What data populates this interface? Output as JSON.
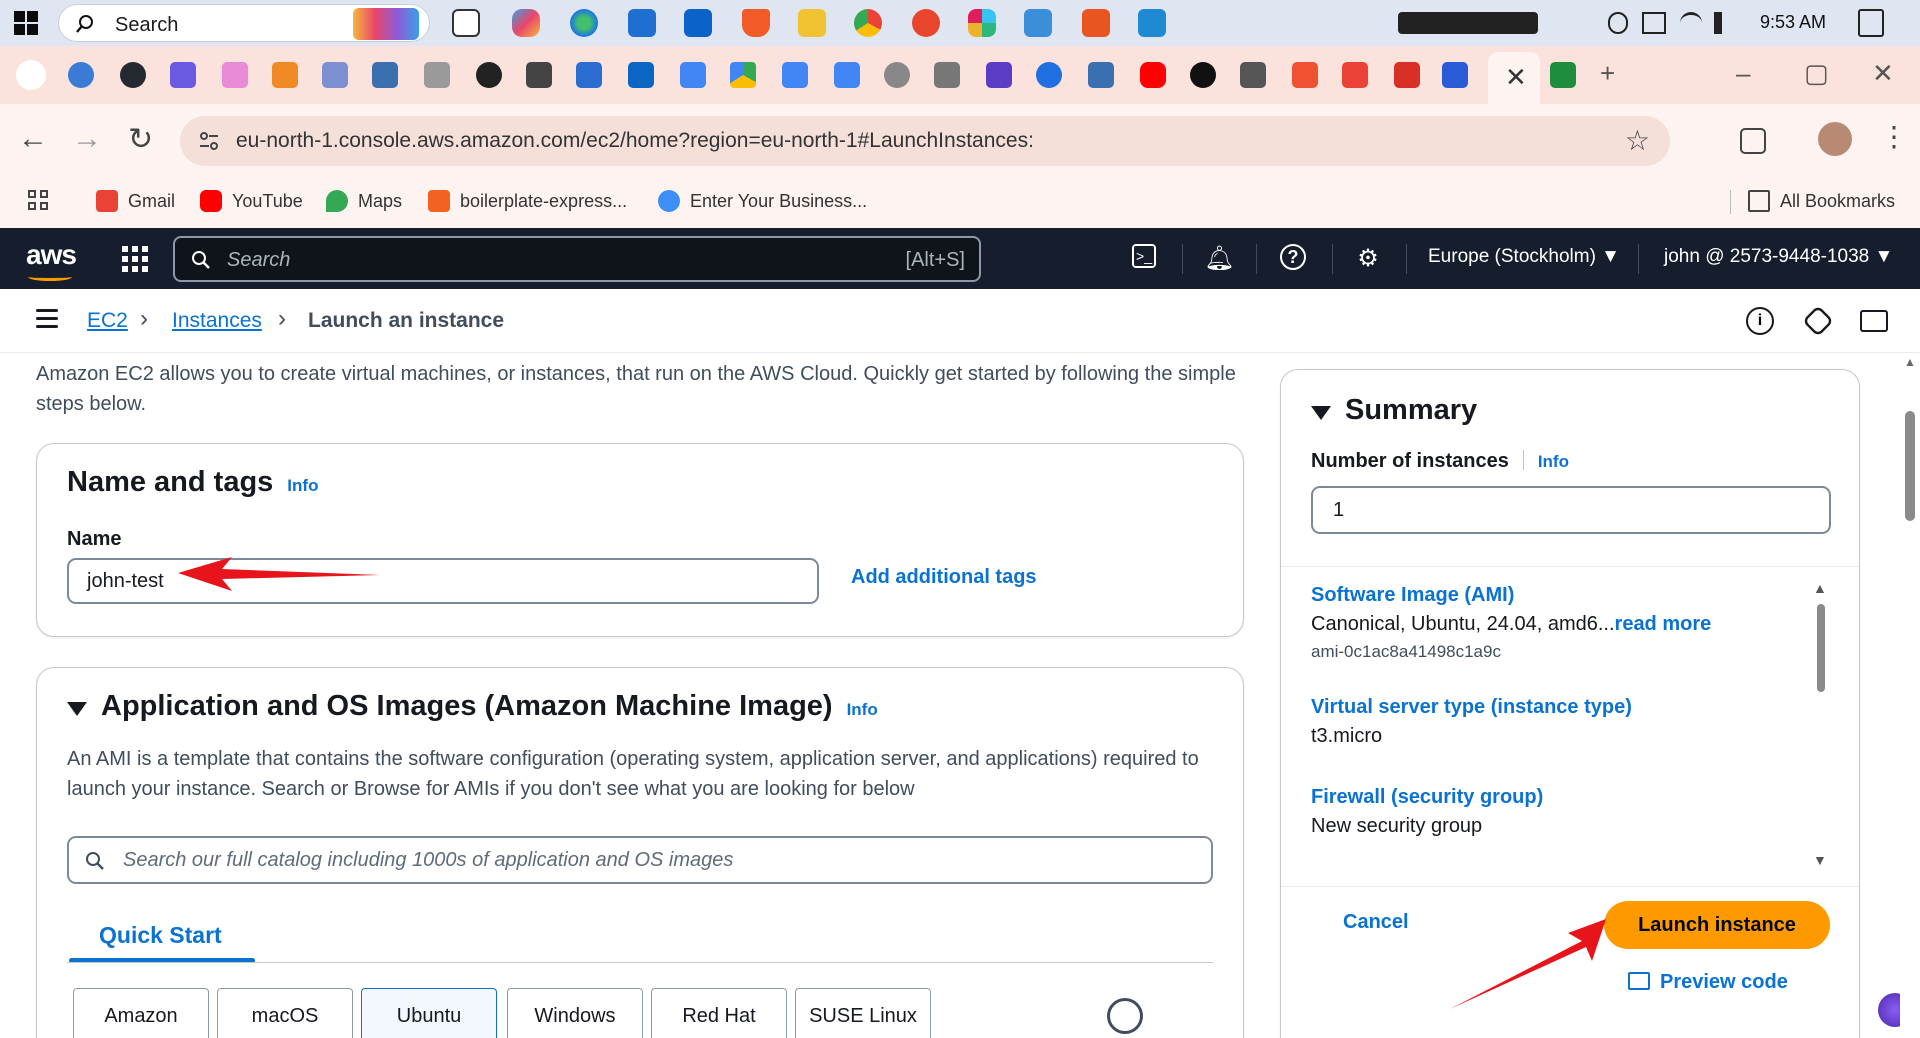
{
  "taskbar": {
    "search_label": "Search",
    "time": "9:53 AM"
  },
  "browser": {
    "url": "eu-north-1.console.aws.amazon.com/ec2/home?region=eu-north-1#LaunchInstances:",
    "bookmarks": [
      "Gmail",
      "YouTube",
      "Maps",
      "boilerplate-express...",
      "Enter Your Business..."
    ],
    "all_bookmarks": "All Bookmarks",
    "active_tab_close": "✕",
    "new_tab": "+"
  },
  "aws_header": {
    "logo": "aws",
    "search_placeholder": "Search",
    "search_shortcut": "[Alt+S]",
    "region": "Europe (Stockholm) ▼",
    "account": "john @ 2573-9448-1038 ▼"
  },
  "breadcrumb": {
    "ec2": "EC2",
    "instances": "Instances",
    "current": "Launch an instance"
  },
  "intro": "Amazon EC2 allows you to create virtual machines, or instances, that run on the AWS Cloud. Quickly get started by following the simple steps below.",
  "name_tags": {
    "title": "Name and tags",
    "info": "Info",
    "name_label": "Name",
    "name_value": "john-test",
    "add_tags": "Add additional tags"
  },
  "ami": {
    "title": "Application and OS Images (Amazon Machine Image)",
    "info": "Info",
    "description": "An AMI is a template that contains the software configuration (operating system, application server, and applications) required to launch your instance. Search or Browse for AMIs if you don't see what you are looking for below",
    "search_placeholder": "Search our full catalog including 1000s of application and OS images",
    "quick_start": "Quick Start",
    "os_tabs": [
      "Amazon",
      "macOS",
      "Ubuntu",
      "Windows",
      "Red Hat",
      "SUSE Linux"
    ]
  },
  "summary": {
    "title": "Summary",
    "instances_label": "Number of instances",
    "info": "Info",
    "instances_value": "1",
    "ami_label": "Software Image (AMI)",
    "ami_value": "Canonical, Ubuntu, 24.04, amd6...",
    "ami_readmore": "read more",
    "ami_id": "ami-0c1ac8a41498c1a9c",
    "type_label": "Virtual server type (instance type)",
    "type_value": "t3.micro",
    "firewall_label": "Firewall (security group)",
    "firewall_value": "New security group",
    "cancel": "Cancel",
    "launch": "Launch instance",
    "preview": "Preview code"
  },
  "colors": {
    "aws_header": "#161e2d",
    "link": "#0972d3",
    "launch": "#ff9900",
    "annotation_arrow": "#e8141b"
  }
}
